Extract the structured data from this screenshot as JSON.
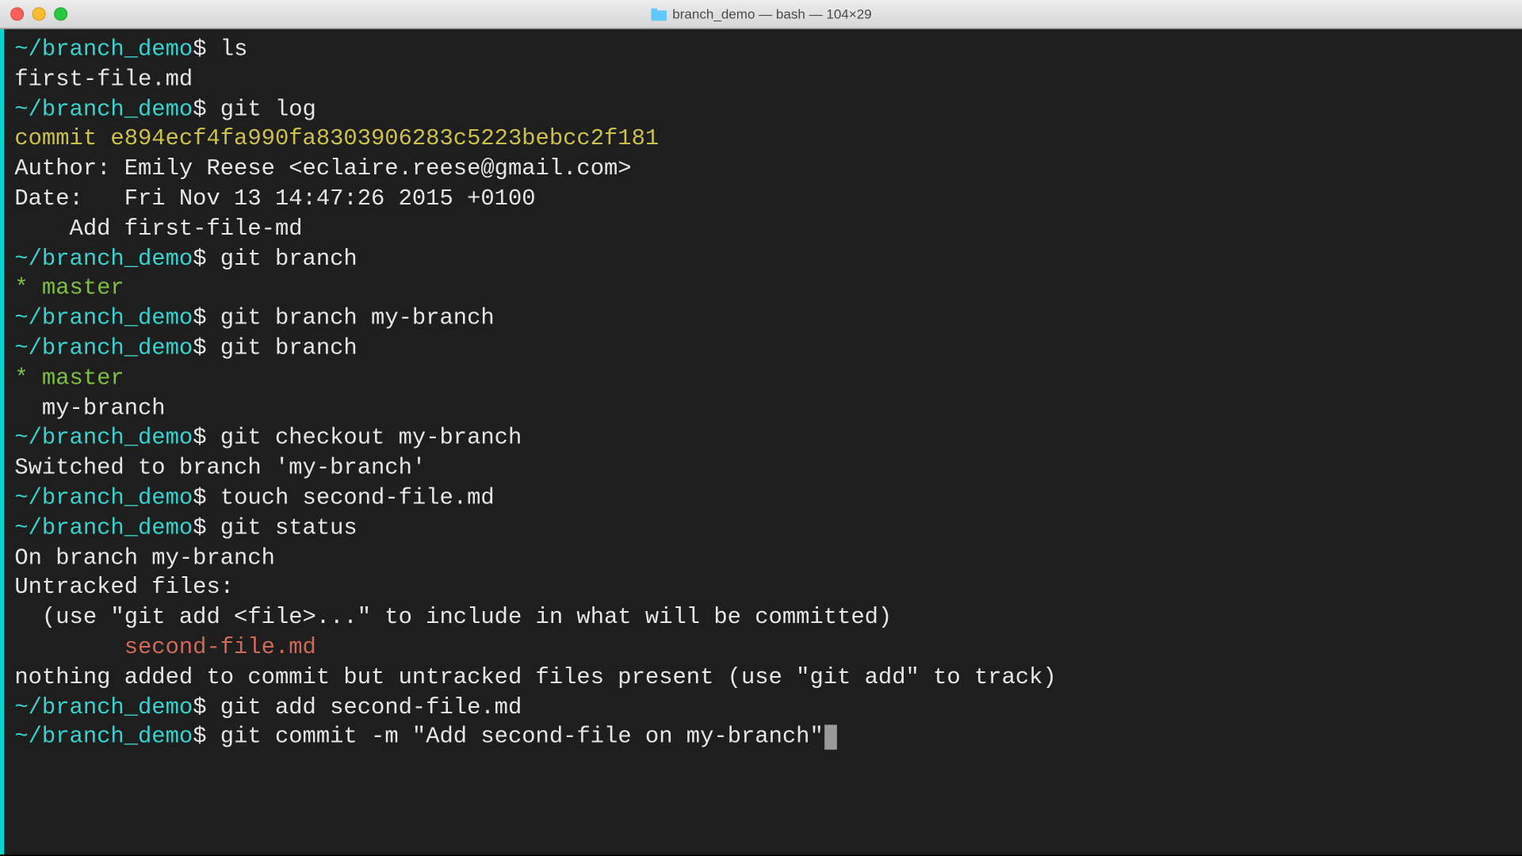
{
  "titlebar": {
    "icon": "folder-icon",
    "title": "branch_demo — bash — 104×29"
  },
  "colors": {
    "accent": "#37d4cf",
    "commit": "#cdc14a",
    "branch": "#7fbf3f",
    "untracked": "#d06a58"
  },
  "lines": [
    {
      "type": "prompt",
      "path": "~/branch_demo",
      "sep": "$ ",
      "cmd": "ls"
    },
    {
      "type": "out",
      "text": "first-file.md"
    },
    {
      "type": "prompt",
      "path": "~/branch_demo",
      "sep": "$ ",
      "cmd": "git log"
    },
    {
      "type": "commit",
      "text": "commit e894ecf4fa990fa8303906283c5223bebcc2f181"
    },
    {
      "type": "out",
      "text": "Author: Emily Reese <eclaire.reese@gmail.com>"
    },
    {
      "type": "out",
      "text": "Date:   Fri Nov 13 14:47:26 2015 +0100"
    },
    {
      "type": "out",
      "text": ""
    },
    {
      "type": "out",
      "text": "    Add first-file-md"
    },
    {
      "type": "prompt",
      "path": "~/branch_demo",
      "sep": "$ ",
      "cmd": "git branch"
    },
    {
      "type": "branch-active",
      "prefix": "* ",
      "name": "master"
    },
    {
      "type": "prompt",
      "path": "~/branch_demo",
      "sep": "$ ",
      "cmd": "git branch my-branch"
    },
    {
      "type": "prompt",
      "path": "~/branch_demo",
      "sep": "$ ",
      "cmd": "git branch"
    },
    {
      "type": "branch-active",
      "prefix": "* ",
      "name": "master"
    },
    {
      "type": "out",
      "text": "  my-branch"
    },
    {
      "type": "prompt",
      "path": "~/branch_demo",
      "sep": "$ ",
      "cmd": "git checkout my-branch"
    },
    {
      "type": "out",
      "text": "Switched to branch 'my-branch'"
    },
    {
      "type": "prompt",
      "path": "~/branch_demo",
      "sep": "$ ",
      "cmd": "touch second-file.md"
    },
    {
      "type": "prompt",
      "path": "~/branch_demo",
      "sep": "$ ",
      "cmd": "git status"
    },
    {
      "type": "out",
      "text": "On branch my-branch"
    },
    {
      "type": "out",
      "text": "Untracked files:"
    },
    {
      "type": "out",
      "text": "  (use \"git add <file>...\" to include in what will be committed)"
    },
    {
      "type": "out",
      "text": ""
    },
    {
      "type": "untracked",
      "text": "        second-file.md"
    },
    {
      "type": "out",
      "text": ""
    },
    {
      "type": "out",
      "text": "nothing added to commit but untracked files present (use \"git add\" to track)"
    },
    {
      "type": "prompt",
      "path": "~/branch_demo",
      "sep": "$ ",
      "cmd": "git add second-file.md"
    },
    {
      "type": "prompt-cursor",
      "path": "~/branch_demo",
      "sep": "$ ",
      "cmd": "git commit -m \"Add second-file on my-branch\""
    }
  ]
}
